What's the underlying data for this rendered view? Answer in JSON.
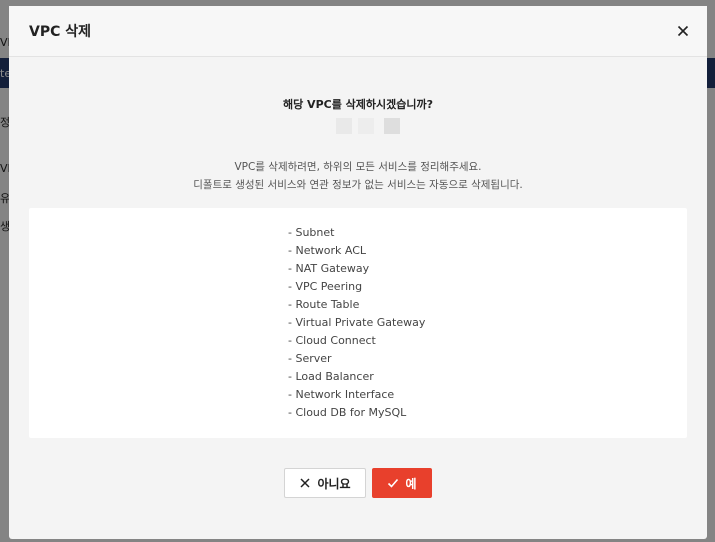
{
  "background": {
    "fragments": [
      "VI",
      "te",
      "정",
      "VI",
      "유",
      "생"
    ]
  },
  "dialog": {
    "title": "VPC 삭제",
    "question": "해당 VPC를 삭제하시겠습니까?",
    "description_lines": [
      "VPC를 삭제하려면, 하위의 모든 서비스를 정리해주세요.",
      "디폴트로 생성된 서비스와 연관 정보가 없는 서비스는 자동으로 삭제됩니다."
    ],
    "services": [
      "- Subnet",
      "- Network ACL",
      "- NAT Gateway",
      "- VPC Peering",
      "- Route Table",
      "- Virtual Private Gateway",
      "- Cloud Connect",
      "- Server",
      "- Load Balancer",
      "- Network Interface",
      "- Cloud DB for MySQL"
    ],
    "buttons": {
      "cancel_label": "아니요",
      "confirm_label": "예"
    },
    "icons": {
      "close": "close-icon",
      "cancel": "x-icon",
      "confirm": "check-icon"
    },
    "colors": {
      "confirm_bg": "#e8402c",
      "header_band": "#243a6b"
    }
  }
}
